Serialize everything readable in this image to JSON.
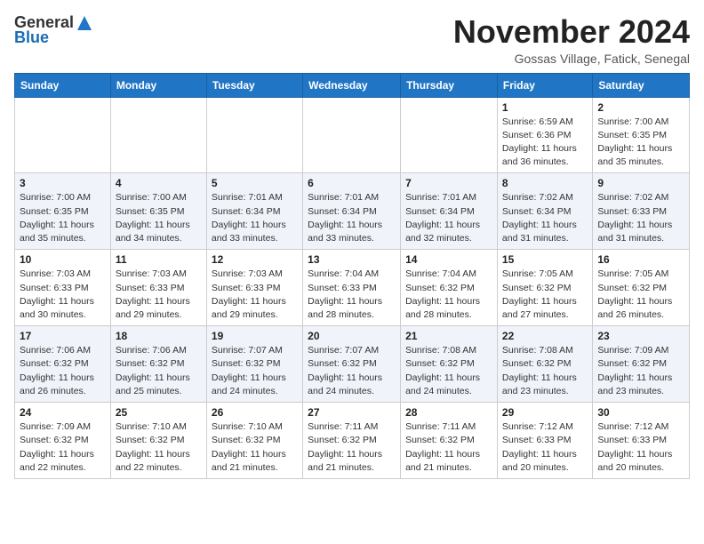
{
  "header": {
    "logo_general": "General",
    "logo_blue": "Blue",
    "month_title": "November 2024",
    "subtitle": "Gossas Village, Fatick, Senegal"
  },
  "days_of_week": [
    "Sunday",
    "Monday",
    "Tuesday",
    "Wednesday",
    "Thursday",
    "Friday",
    "Saturday"
  ],
  "weeks": [
    [
      {
        "day": "",
        "info": ""
      },
      {
        "day": "",
        "info": ""
      },
      {
        "day": "",
        "info": ""
      },
      {
        "day": "",
        "info": ""
      },
      {
        "day": "",
        "info": ""
      },
      {
        "day": "1",
        "info": "Sunrise: 6:59 AM\nSunset: 6:36 PM\nDaylight: 11 hours and 36 minutes."
      },
      {
        "day": "2",
        "info": "Sunrise: 7:00 AM\nSunset: 6:35 PM\nDaylight: 11 hours and 35 minutes."
      }
    ],
    [
      {
        "day": "3",
        "info": "Sunrise: 7:00 AM\nSunset: 6:35 PM\nDaylight: 11 hours and 35 minutes."
      },
      {
        "day": "4",
        "info": "Sunrise: 7:00 AM\nSunset: 6:35 PM\nDaylight: 11 hours and 34 minutes."
      },
      {
        "day": "5",
        "info": "Sunrise: 7:01 AM\nSunset: 6:34 PM\nDaylight: 11 hours and 33 minutes."
      },
      {
        "day": "6",
        "info": "Sunrise: 7:01 AM\nSunset: 6:34 PM\nDaylight: 11 hours and 33 minutes."
      },
      {
        "day": "7",
        "info": "Sunrise: 7:01 AM\nSunset: 6:34 PM\nDaylight: 11 hours and 32 minutes."
      },
      {
        "day": "8",
        "info": "Sunrise: 7:02 AM\nSunset: 6:34 PM\nDaylight: 11 hours and 31 minutes."
      },
      {
        "day": "9",
        "info": "Sunrise: 7:02 AM\nSunset: 6:33 PM\nDaylight: 11 hours and 31 minutes."
      }
    ],
    [
      {
        "day": "10",
        "info": "Sunrise: 7:03 AM\nSunset: 6:33 PM\nDaylight: 11 hours and 30 minutes."
      },
      {
        "day": "11",
        "info": "Sunrise: 7:03 AM\nSunset: 6:33 PM\nDaylight: 11 hours and 29 minutes."
      },
      {
        "day": "12",
        "info": "Sunrise: 7:03 AM\nSunset: 6:33 PM\nDaylight: 11 hours and 29 minutes."
      },
      {
        "day": "13",
        "info": "Sunrise: 7:04 AM\nSunset: 6:33 PM\nDaylight: 11 hours and 28 minutes."
      },
      {
        "day": "14",
        "info": "Sunrise: 7:04 AM\nSunset: 6:32 PM\nDaylight: 11 hours and 28 minutes."
      },
      {
        "day": "15",
        "info": "Sunrise: 7:05 AM\nSunset: 6:32 PM\nDaylight: 11 hours and 27 minutes."
      },
      {
        "day": "16",
        "info": "Sunrise: 7:05 AM\nSunset: 6:32 PM\nDaylight: 11 hours and 26 minutes."
      }
    ],
    [
      {
        "day": "17",
        "info": "Sunrise: 7:06 AM\nSunset: 6:32 PM\nDaylight: 11 hours and 26 minutes."
      },
      {
        "day": "18",
        "info": "Sunrise: 7:06 AM\nSunset: 6:32 PM\nDaylight: 11 hours and 25 minutes."
      },
      {
        "day": "19",
        "info": "Sunrise: 7:07 AM\nSunset: 6:32 PM\nDaylight: 11 hours and 24 minutes."
      },
      {
        "day": "20",
        "info": "Sunrise: 7:07 AM\nSunset: 6:32 PM\nDaylight: 11 hours and 24 minutes."
      },
      {
        "day": "21",
        "info": "Sunrise: 7:08 AM\nSunset: 6:32 PM\nDaylight: 11 hours and 24 minutes."
      },
      {
        "day": "22",
        "info": "Sunrise: 7:08 AM\nSunset: 6:32 PM\nDaylight: 11 hours and 23 minutes."
      },
      {
        "day": "23",
        "info": "Sunrise: 7:09 AM\nSunset: 6:32 PM\nDaylight: 11 hours and 23 minutes."
      }
    ],
    [
      {
        "day": "24",
        "info": "Sunrise: 7:09 AM\nSunset: 6:32 PM\nDaylight: 11 hours and 22 minutes."
      },
      {
        "day": "25",
        "info": "Sunrise: 7:10 AM\nSunset: 6:32 PM\nDaylight: 11 hours and 22 minutes."
      },
      {
        "day": "26",
        "info": "Sunrise: 7:10 AM\nSunset: 6:32 PM\nDaylight: 11 hours and 21 minutes."
      },
      {
        "day": "27",
        "info": "Sunrise: 7:11 AM\nSunset: 6:32 PM\nDaylight: 11 hours and 21 minutes."
      },
      {
        "day": "28",
        "info": "Sunrise: 7:11 AM\nSunset: 6:32 PM\nDaylight: 11 hours and 21 minutes."
      },
      {
        "day": "29",
        "info": "Sunrise: 7:12 AM\nSunset: 6:33 PM\nDaylight: 11 hours and 20 minutes."
      },
      {
        "day": "30",
        "info": "Sunrise: 7:12 AM\nSunset: 6:33 PM\nDaylight: 11 hours and 20 minutes."
      }
    ]
  ]
}
